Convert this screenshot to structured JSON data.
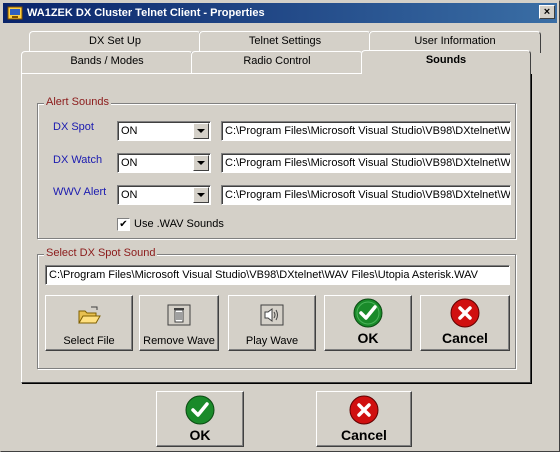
{
  "window": {
    "title": "WA1ZEK DX Cluster Telnet Client - Properties",
    "close_glyph": "×"
  },
  "tabs": {
    "row_back": [
      "DX Set Up",
      "Telnet Settings",
      "User Information"
    ],
    "row_front": [
      "Bands / Modes",
      "Radio Control",
      "Sounds"
    ],
    "active": "Sounds"
  },
  "alert_sounds": {
    "legend": "Alert Sounds",
    "rows": [
      {
        "label": "DX Spot",
        "state": "ON",
        "path": "C:\\Program Files\\Microsoft Visual Studio\\VB98\\DXtelnet\\W"
      },
      {
        "label": "DX Watch",
        "state": "ON",
        "path": "C:\\Program Files\\Microsoft Visual Studio\\VB98\\DXtelnet\\W"
      },
      {
        "label": "WWV Alert",
        "state": "ON",
        "path": "C:\\Program Files\\Microsoft Visual Studio\\VB98\\DXtelnet\\W"
      }
    ],
    "use_wav_label": "Use .WAV Sounds",
    "use_wav_checked": "✔"
  },
  "select_sound": {
    "legend": "Select DX Spot Sound",
    "path": "C:\\Program Files\\Microsoft Visual Studio\\VB98\\DXtelnet\\WAV Files\\Utopia Asterisk.WAV"
  },
  "buttons": {
    "select_file": "Select File",
    "remove_wave": "Remove Wave",
    "play_wave": "Play Wave",
    "ok_inner": "OK",
    "cancel_inner": "Cancel",
    "ok": "OK",
    "cancel": "Cancel"
  },
  "colors": {
    "face": "#d4d0c8",
    "title_start": "#0a246a",
    "title_end": "#3a6ea5",
    "legend": "#8b1a1a",
    "label": "#1a1ab0",
    "ok_green": "#1a8a2a",
    "cancel_red": "#d01010"
  }
}
